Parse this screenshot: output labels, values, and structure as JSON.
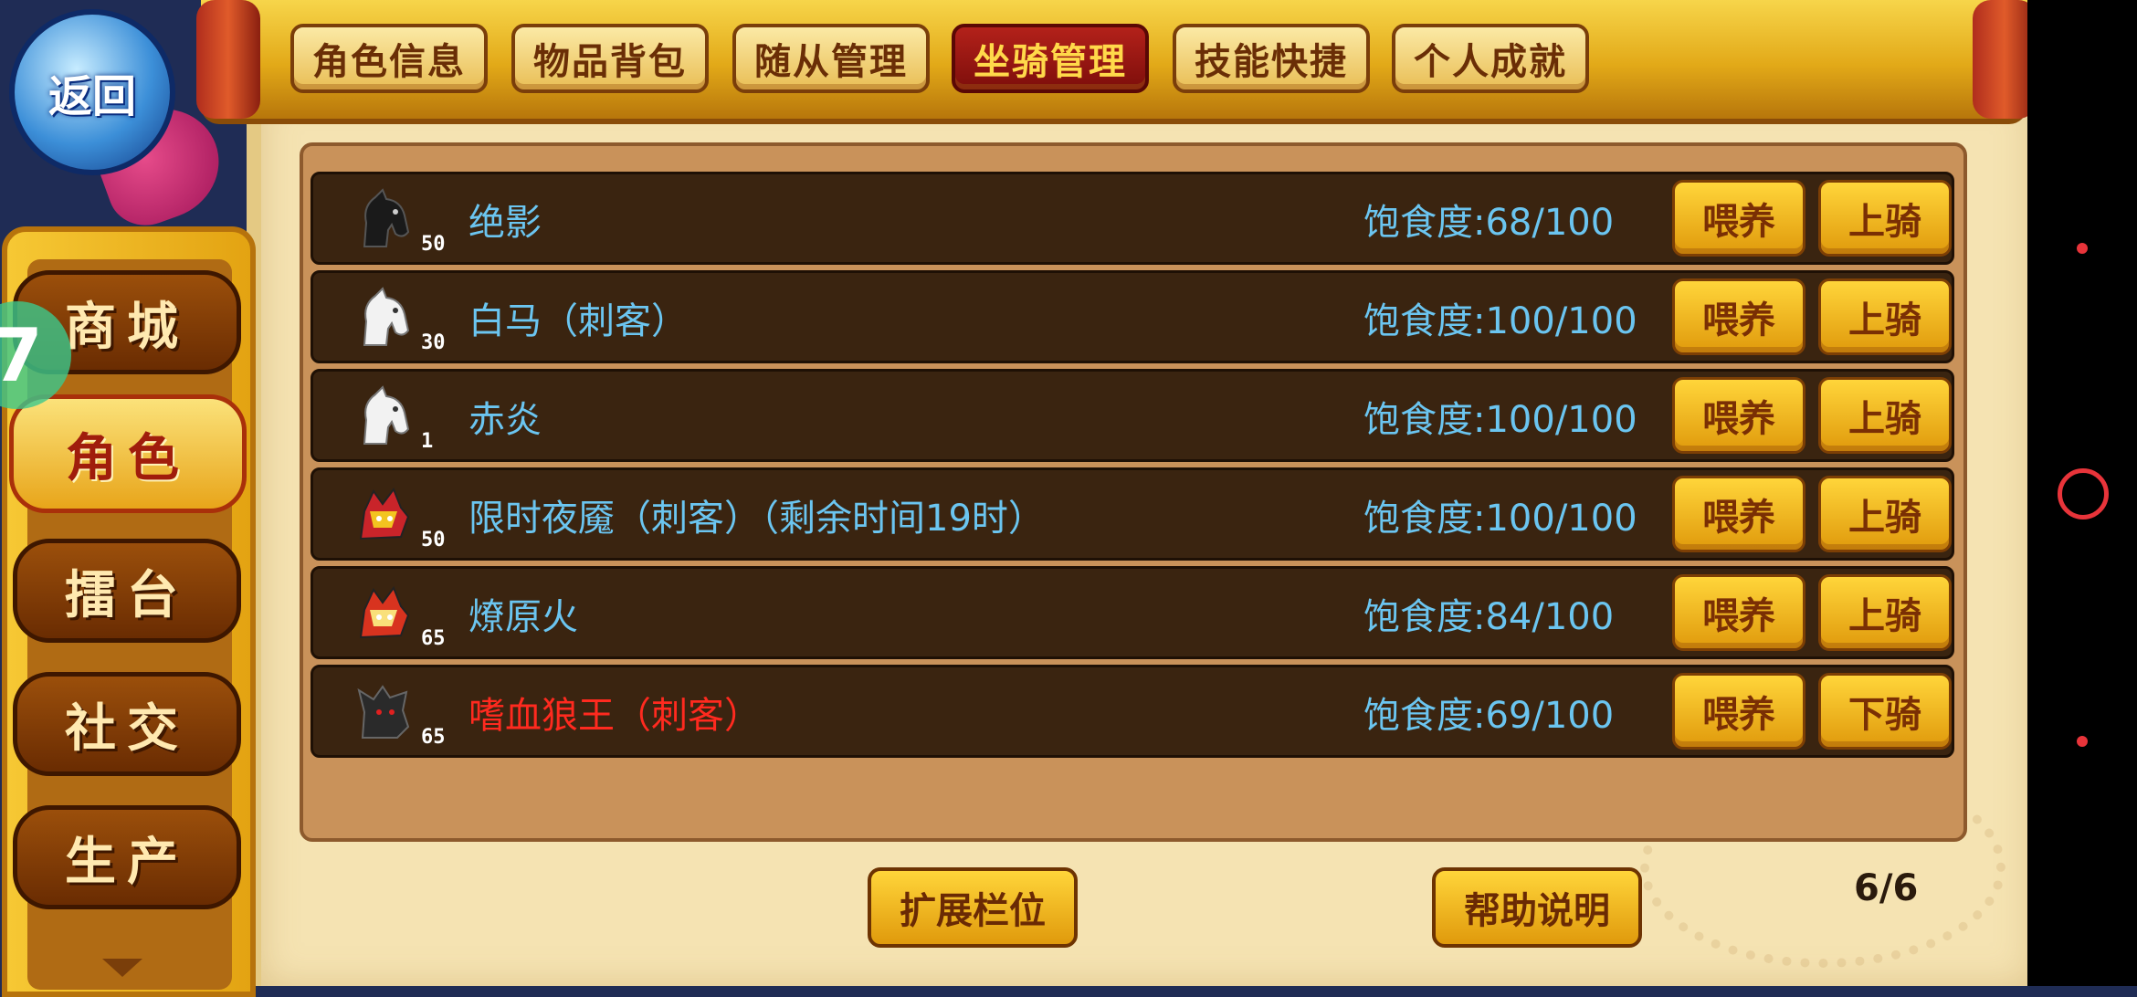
{
  "back_button": {
    "label": "返回"
  },
  "tabs": [
    {
      "label": "角色信息",
      "active": false
    },
    {
      "label": "物品背包",
      "active": false
    },
    {
      "label": "随从管理",
      "active": false
    },
    {
      "label": "坐骑管理",
      "active": true
    },
    {
      "label": "技能快捷",
      "active": false
    },
    {
      "label": "个人成就",
      "active": false
    }
  ],
  "sidebar": {
    "items": [
      {
        "label": "商城"
      },
      {
        "label": "角色",
        "active": true
      },
      {
        "label": "擂台"
      },
      {
        "label": "社交"
      },
      {
        "label": "生产"
      }
    ],
    "badge": "7"
  },
  "mounts": [
    {
      "name": "绝影",
      "level": "50",
      "satiety_label": "饱食度:68/100",
      "feed": "喂养",
      "ride": "上骑",
      "icon": "black-horse-icon"
    },
    {
      "name": "白马（刺客）",
      "level": "30",
      "satiety_label": "饱食度:100/100",
      "feed": "喂养",
      "ride": "上骑",
      "icon": "white-horse-icon"
    },
    {
      "name": "赤炎",
      "level": "1",
      "satiety_label": "饱食度:100/100",
      "feed": "喂养",
      "ride": "上骑",
      "icon": "white-horse-icon"
    },
    {
      "name": "限时夜魇（刺客）（剩余时间19时）",
      "level": "50",
      "satiety_label": "饱食度:100/100",
      "feed": "喂养",
      "ride": "上骑",
      "icon": "armored-beast-icon"
    },
    {
      "name": "燎原火",
      "level": "65",
      "satiety_label": "饱食度:84/100",
      "feed": "喂养",
      "ride": "上骑",
      "icon": "armored-beast-icon"
    },
    {
      "name": "嗜血狼王（刺客）",
      "level": "65",
      "satiety_label": "饱食度:69/100",
      "feed": "喂养",
      "ride": "下骑",
      "icon": "black-wolf-icon",
      "highlight": true
    }
  ],
  "footer": {
    "expand_label": "扩展栏位",
    "help_label": "帮助说明",
    "page": "6/6"
  },
  "colors": {
    "name_blue": "#6bc5f0",
    "name_red": "#ff2a1f",
    "gold": "#e09a0c",
    "row_bg": "#3a2410"
  }
}
